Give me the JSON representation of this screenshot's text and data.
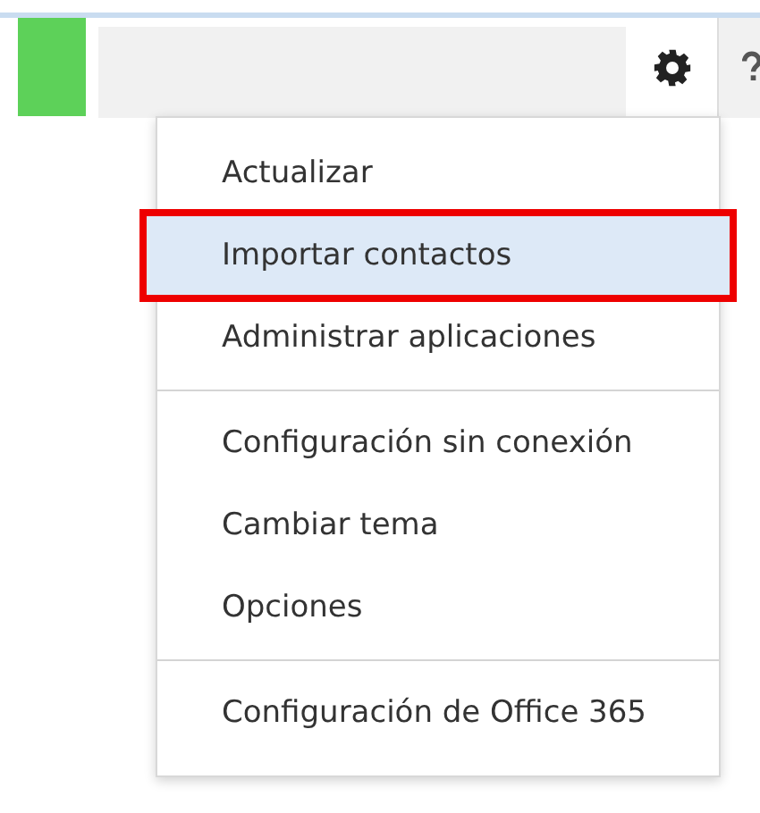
{
  "menu": {
    "groups": [
      {
        "items": [
          {
            "label": "Actualizar",
            "selected": false,
            "annotated": false
          },
          {
            "label": "Importar contactos",
            "selected": true,
            "annotated": true
          },
          {
            "label": "Administrar aplicaciones",
            "selected": false,
            "annotated": false
          }
        ]
      },
      {
        "items": [
          {
            "label": "Configuración sin conexión",
            "selected": false,
            "annotated": false
          },
          {
            "label": "Cambiar tema",
            "selected": false,
            "annotated": false
          },
          {
            "label": "Opciones",
            "selected": false,
            "annotated": false
          }
        ]
      },
      {
        "items": [
          {
            "label": "Configuración de Office 365",
            "selected": false,
            "annotated": false
          }
        ]
      }
    ]
  }
}
